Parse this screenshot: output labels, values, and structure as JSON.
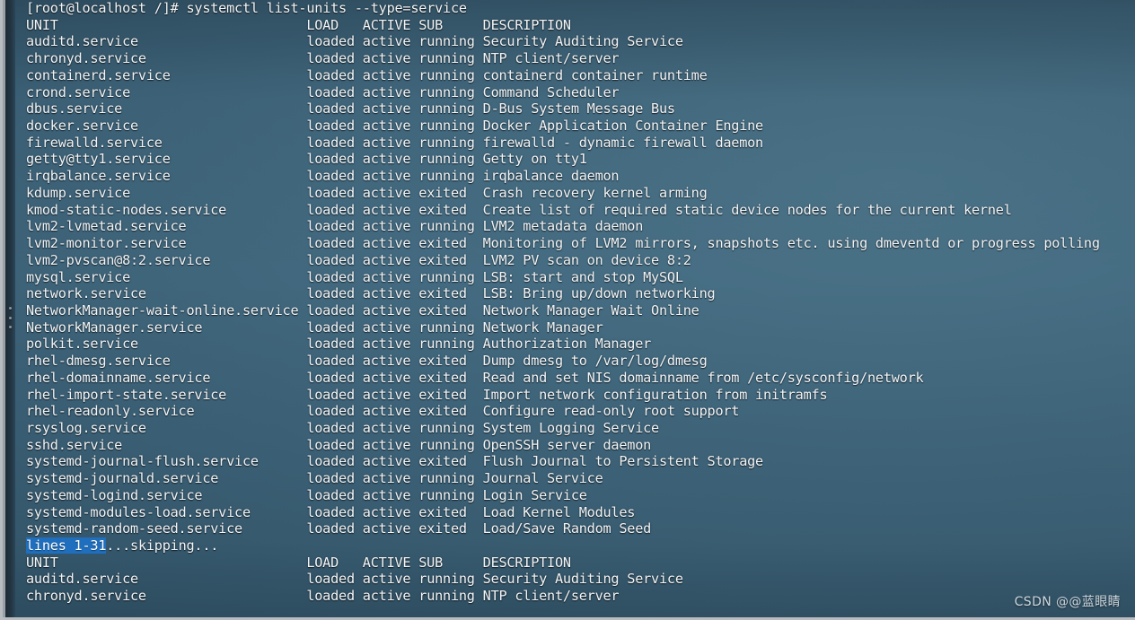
{
  "window": {
    "title": "systemctl list-units --type=service",
    "frame_color": "#b8bcc0",
    "background_color": "#3b6076",
    "foreground_color": "#f2f5f7",
    "highlight_color": "#1f6fbe"
  },
  "splitter": {
    "name": "pane-splitter-handle",
    "dots": 3
  },
  "watermark": {
    "text": "CSDN @@蓝眼睛"
  },
  "terminal": {
    "partial_top_line": "loaded active running NTP client/server",
    "prompt": {
      "user_host": "[root@localhost /]#",
      "command": " systemctl list-units --type=service",
      "full": "[root@localhost /]# systemctl list-units --type=service"
    },
    "columns": {
      "unit": "UNIT",
      "load": "LOAD",
      "active": "ACTIVE",
      "sub": "SUB",
      "description": "DESCRIPTION"
    },
    "header_line": "UNIT                               LOAD   ACTIVE SUB     DESCRIPTION",
    "pager_status": {
      "highlighted": "lines 1-31",
      "trailing": "...skipping..."
    },
    "rows": [
      {
        "unit": "auditd.service",
        "load": "loaded",
        "active": "active",
        "sub": "running",
        "description": "Security Auditing Service"
      },
      {
        "unit": "chronyd.service",
        "load": "loaded",
        "active": "active",
        "sub": "running",
        "description": "NTP client/server"
      },
      {
        "unit": "containerd.service",
        "load": "loaded",
        "active": "active",
        "sub": "running",
        "description": "containerd container runtime"
      },
      {
        "unit": "crond.service",
        "load": "loaded",
        "active": "active",
        "sub": "running",
        "description": "Command Scheduler"
      },
      {
        "unit": "dbus.service",
        "load": "loaded",
        "active": "active",
        "sub": "running",
        "description": "D-Bus System Message Bus"
      },
      {
        "unit": "docker.service",
        "load": "loaded",
        "active": "active",
        "sub": "running",
        "description": "Docker Application Container Engine"
      },
      {
        "unit": "firewalld.service",
        "load": "loaded",
        "active": "active",
        "sub": "running",
        "description": "firewalld - dynamic firewall daemon"
      },
      {
        "unit": "getty@tty1.service",
        "load": "loaded",
        "active": "active",
        "sub": "running",
        "description": "Getty on tty1"
      },
      {
        "unit": "irqbalance.service",
        "load": "loaded",
        "active": "active",
        "sub": "running",
        "description": "irqbalance daemon"
      },
      {
        "unit": "kdump.service",
        "load": "loaded",
        "active": "active",
        "sub": "exited",
        "description": "Crash recovery kernel arming"
      },
      {
        "unit": "kmod-static-nodes.service",
        "load": "loaded",
        "active": "active",
        "sub": "exited",
        "description": "Create list of required static device nodes for the current kernel"
      },
      {
        "unit": "lvm2-lvmetad.service",
        "load": "loaded",
        "active": "active",
        "sub": "running",
        "description": "LVM2 metadata daemon"
      },
      {
        "unit": "lvm2-monitor.service",
        "load": "loaded",
        "active": "active",
        "sub": "exited",
        "description": "Monitoring of LVM2 mirrors, snapshots etc. using dmeventd or progress polling"
      },
      {
        "unit": "lvm2-pvscan@8:2.service",
        "load": "loaded",
        "active": "active",
        "sub": "exited",
        "description": "LVM2 PV scan on device 8:2"
      },
      {
        "unit": "mysql.service",
        "load": "loaded",
        "active": "active",
        "sub": "running",
        "description": "LSB: start and stop MySQL"
      },
      {
        "unit": "network.service",
        "load": "loaded",
        "active": "active",
        "sub": "exited",
        "description": "LSB: Bring up/down networking"
      },
      {
        "unit": "NetworkManager-wait-online.service",
        "load": "loaded",
        "active": "active",
        "sub": "exited",
        "description": "Network Manager Wait Online"
      },
      {
        "unit": "NetworkManager.service",
        "load": "loaded",
        "active": "active",
        "sub": "running",
        "description": "Network Manager"
      },
      {
        "unit": "polkit.service",
        "load": "loaded",
        "active": "active",
        "sub": "running",
        "description": "Authorization Manager"
      },
      {
        "unit": "rhel-dmesg.service",
        "load": "loaded",
        "active": "active",
        "sub": "exited",
        "description": "Dump dmesg to /var/log/dmesg"
      },
      {
        "unit": "rhel-domainname.service",
        "load": "loaded",
        "active": "active",
        "sub": "exited",
        "description": "Read and set NIS domainname from /etc/sysconfig/network"
      },
      {
        "unit": "rhel-import-state.service",
        "load": "loaded",
        "active": "active",
        "sub": "exited",
        "description": "Import network configuration from initramfs"
      },
      {
        "unit": "rhel-readonly.service",
        "load": "loaded",
        "active": "active",
        "sub": "exited",
        "description": "Configure read-only root support"
      },
      {
        "unit": "rsyslog.service",
        "load": "loaded",
        "active": "active",
        "sub": "running",
        "description": "System Logging Service"
      },
      {
        "unit": "sshd.service",
        "load": "loaded",
        "active": "active",
        "sub": "running",
        "description": "OpenSSH server daemon"
      },
      {
        "unit": "systemd-journal-flush.service",
        "load": "loaded",
        "active": "active",
        "sub": "exited",
        "description": "Flush Journal to Persistent Storage"
      },
      {
        "unit": "systemd-journald.service",
        "load": "loaded",
        "active": "active",
        "sub": "running",
        "description": "Journal Service"
      },
      {
        "unit": "systemd-logind.service",
        "load": "loaded",
        "active": "active",
        "sub": "running",
        "description": "Login Service"
      },
      {
        "unit": "systemd-modules-load.service",
        "load": "loaded",
        "active": "active",
        "sub": "exited",
        "description": "Load Kernel Modules"
      },
      {
        "unit": "systemd-random-seed.service",
        "load": "loaded",
        "active": "active",
        "sub": "exited",
        "description": "Load/Save Random Seed"
      }
    ],
    "repeat_rows": [
      {
        "unit": "auditd.service",
        "load": "loaded",
        "active": "active",
        "sub": "running",
        "description": "Security Auditing Service"
      },
      {
        "unit": "chronyd.service",
        "load": "loaded",
        "active": "active",
        "sub": "running",
        "description": "NTP client/server"
      }
    ]
  }
}
